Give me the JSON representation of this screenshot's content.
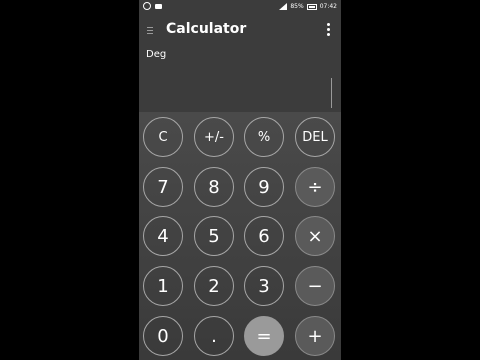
{
  "status_bar": {
    "battery_percent": "85%",
    "time": "07:42"
  },
  "toolbar": {
    "title": "Calculator"
  },
  "display": {
    "angle_mode": "Deg",
    "expression": ""
  },
  "keypad": {
    "row1": [
      "C",
      "+/-",
      "%",
      "DEL"
    ],
    "row2": [
      "7",
      "8",
      "9",
      "÷"
    ],
    "row3": [
      "4",
      "5",
      "6",
      "×"
    ],
    "row4": [
      "1",
      "2",
      "3",
      "−"
    ],
    "row5": [
      "0",
      ".",
      "=",
      "+"
    ]
  }
}
